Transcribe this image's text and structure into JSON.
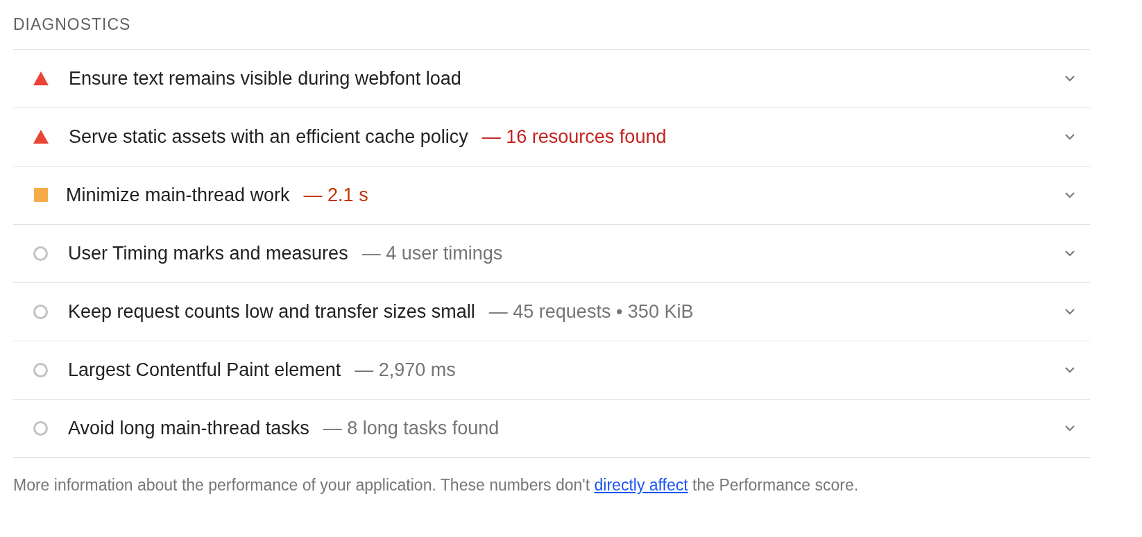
{
  "section": {
    "title": "DIAGNOSTICS"
  },
  "audits": [
    {
      "kind": "fail",
      "title": "Ensure text remains visible during webfont load"
    },
    {
      "kind": "fail",
      "title": "Serve static assets with an efficient cache policy",
      "detail": "— 16 resources found"
    },
    {
      "kind": "average",
      "title": "Minimize main-thread work",
      "detail": "— 2.1 s"
    },
    {
      "kind": "informative",
      "title": "User Timing marks and measures",
      "detail": "— 4 user timings"
    },
    {
      "kind": "informative",
      "title": "Keep request counts low and transfer sizes small",
      "detail": "— 45 requests • 350 KiB"
    },
    {
      "kind": "informative",
      "title": "Largest Contentful Paint element",
      "detail": "— 2,970 ms"
    },
    {
      "kind": "informative",
      "title": "Avoid long main-thread tasks",
      "detail": "— 8 long tasks found"
    }
  ],
  "footer": {
    "text_before": "More information about the performance of your application. These numbers don't",
    "link": "directly affect",
    "text_after": "the Performance score."
  }
}
